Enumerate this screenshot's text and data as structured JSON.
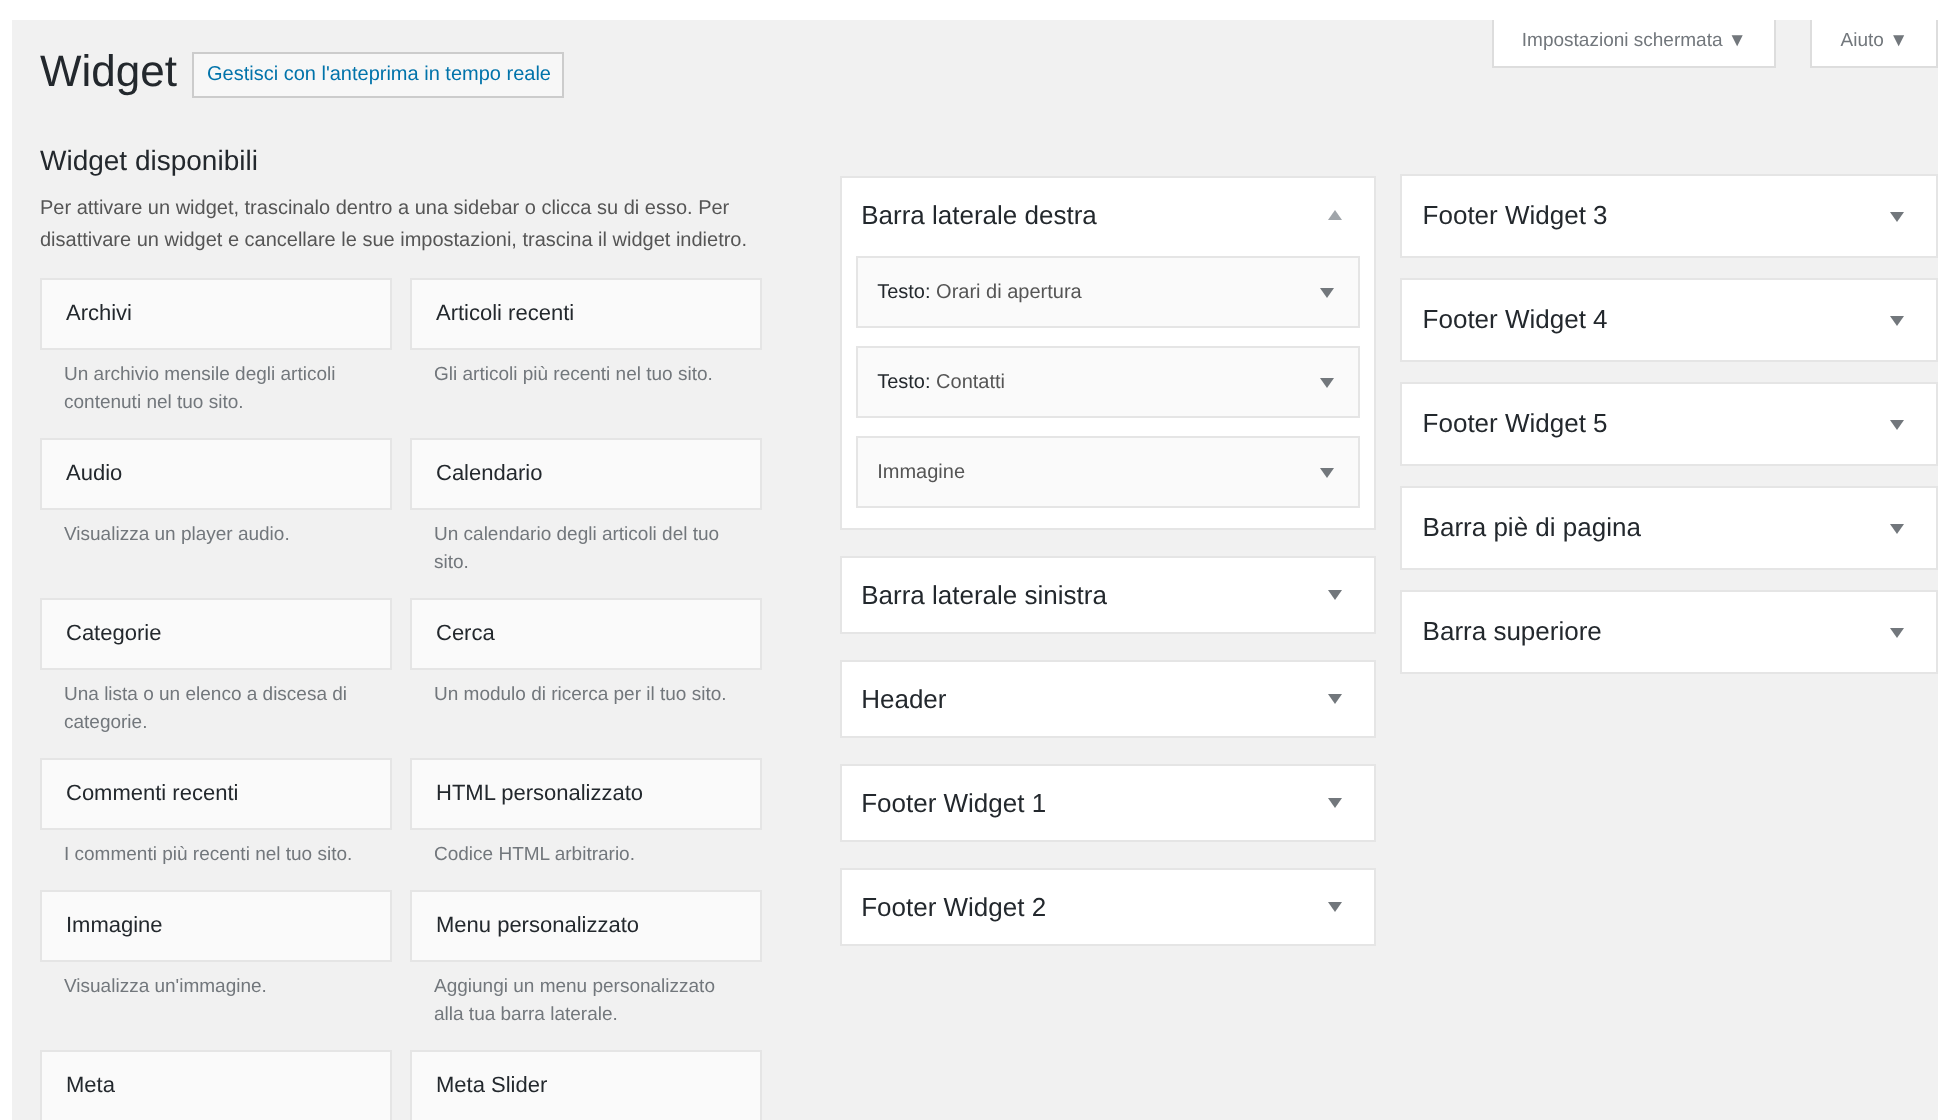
{
  "screen_meta_buttons": [
    {
      "label": "Impostazioni schermata ▼"
    },
    {
      "label": "Aiuto ▼"
    }
  ],
  "title": "Widget",
  "title_action": "Gestisci con l'anteprima in tempo reale",
  "available": {
    "heading": "Widget disponibili",
    "description": "Per attivare un widget, trascinalo dentro a una sidebar o clicca su di esso. Per disattivare un widget e cancellare le sue impostazioni, trascina il widget indietro.",
    "widgets": [
      {
        "title": "Archivi",
        "description": "Un archivio mensile degli articoli contenuti nel tuo sito."
      },
      {
        "title": "Articoli recenti",
        "description": "Gli articoli più recenti nel tuo sito."
      },
      {
        "title": "Audio",
        "description": "Visualizza un player audio."
      },
      {
        "title": "Calendario",
        "description": "Un calendario degli articoli del tuo sito."
      },
      {
        "title": "Categorie",
        "description": "Una lista o un elenco a discesa di categorie."
      },
      {
        "title": "Cerca",
        "description": "Un modulo di ricerca per il tuo sito."
      },
      {
        "title": "Commenti recenti",
        "description": "I commenti più recenti nel tuo sito."
      },
      {
        "title": "HTML personalizzato",
        "description": "Codice HTML arbitrario."
      },
      {
        "title": "Immagine",
        "description": "Visualizza un'immagine."
      },
      {
        "title": "Menu personalizzato",
        "description": "Aggiungi un menu personalizzato alla tua barra laterale."
      },
      {
        "title": "Meta"
      },
      {
        "title": "Meta Slider"
      }
    ]
  },
  "sidebar_columns": [
    [
      {
        "name": "Barra laterale destra",
        "expanded": true,
        "children": [
          {
            "title": "**Testo:** Orari di apertura"
          },
          {
            "title": "**Testo:** Contatti"
          },
          {
            "title": "Immagine"
          }
        ]
      },
      {
        "name": "Barra laterale sinistra",
        "expanded": false
      },
      {
        "name": "Header",
        "expanded": false
      },
      {
        "name": "Footer Widget 1",
        "expanded": false
      },
      {
        "name": "Footer Widget 2",
        "expanded": false
      }
    ],
    [
      {
        "name": "Footer Widget 3",
        "expanded": false
      },
      {
        "name": "Footer Widget 4",
        "expanded": false
      },
      {
        "name": "Footer Widget 5",
        "expanded": false
      },
      {
        "name": "Barra piè di pagina",
        "expanded": false
      },
      {
        "name": "Barra superiore",
        "expanded": false
      }
    ]
  ]
}
